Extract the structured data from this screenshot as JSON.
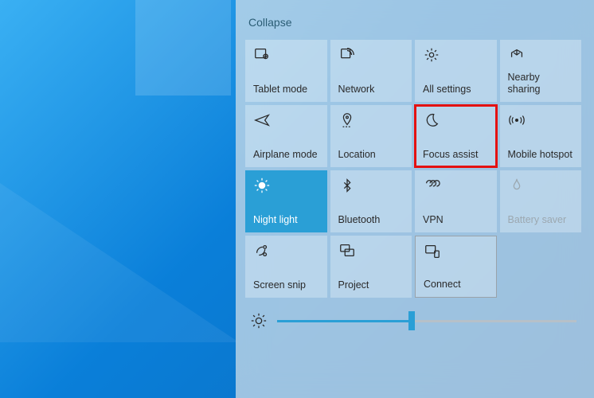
{
  "wallpaper": {
    "theme": "Windows 10 Light (blue)"
  },
  "action_center": {
    "collapse_label": "Collapse",
    "tiles": [
      {
        "id": "tablet-mode",
        "icon": "tablet-mode-icon",
        "label": "Tablet mode",
        "active": false,
        "disabled": false,
        "highlighted": false,
        "bordered": false
      },
      {
        "id": "network",
        "icon": "network-icon",
        "label": "Network",
        "active": false,
        "disabled": false,
        "highlighted": false,
        "bordered": false
      },
      {
        "id": "all-settings",
        "icon": "settings-icon",
        "label": "All settings",
        "active": false,
        "disabled": false,
        "highlighted": false,
        "bordered": false
      },
      {
        "id": "nearby-sharing",
        "icon": "nearby-sharing-icon",
        "label": "Nearby sharing",
        "active": false,
        "disabled": false,
        "highlighted": false,
        "bordered": false
      },
      {
        "id": "airplane-mode",
        "icon": "airplane-icon",
        "label": "Airplane mode",
        "active": false,
        "disabled": false,
        "highlighted": false,
        "bordered": false
      },
      {
        "id": "location",
        "icon": "location-icon",
        "label": "Location",
        "active": false,
        "disabled": false,
        "highlighted": false,
        "bordered": false
      },
      {
        "id": "focus-assist",
        "icon": "moon-icon",
        "label": "Focus assist",
        "active": false,
        "disabled": false,
        "highlighted": true,
        "bordered": false
      },
      {
        "id": "mobile-hotspot",
        "icon": "hotspot-icon",
        "label": "Mobile hotspot",
        "active": false,
        "disabled": false,
        "highlighted": false,
        "bordered": false
      },
      {
        "id": "night-light",
        "icon": "night-light-icon",
        "label": "Night light",
        "active": true,
        "disabled": false,
        "highlighted": false,
        "bordered": false
      },
      {
        "id": "bluetooth",
        "icon": "bluetooth-icon",
        "label": "Bluetooth",
        "active": false,
        "disabled": false,
        "highlighted": false,
        "bordered": false
      },
      {
        "id": "vpn",
        "icon": "vpn-icon",
        "label": "VPN",
        "active": false,
        "disabled": false,
        "highlighted": false,
        "bordered": false
      },
      {
        "id": "battery-saver",
        "icon": "battery-saver-icon",
        "label": "Battery saver",
        "active": false,
        "disabled": true,
        "highlighted": false,
        "bordered": false
      },
      {
        "id": "screen-snip",
        "icon": "screen-snip-icon",
        "label": "Screen snip",
        "active": false,
        "disabled": false,
        "highlighted": false,
        "bordered": false
      },
      {
        "id": "project",
        "icon": "project-icon",
        "label": "Project",
        "active": false,
        "disabled": false,
        "highlighted": false,
        "bordered": false
      },
      {
        "id": "connect",
        "icon": "connect-icon",
        "label": "Connect",
        "active": false,
        "disabled": false,
        "highlighted": false,
        "bordered": true
      }
    ],
    "brightness": {
      "icon": "brightness-icon",
      "value_percent": 45
    },
    "colors": {
      "accent": "#2a9fd6",
      "highlight_border": "#e41111",
      "panel_bg": "rgba(214,224,233,0.72)"
    }
  }
}
